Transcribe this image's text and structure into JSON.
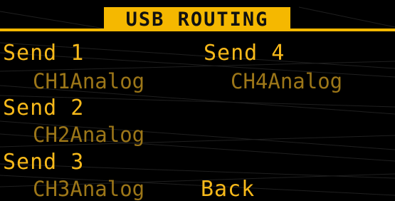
{
  "title": "USB ROUTING",
  "sends": [
    {
      "label": "Send 1",
      "source": "CH1Analog"
    },
    {
      "label": "Send 2",
      "source": "CH2Analog"
    },
    {
      "label": "Send 3",
      "source": "CH3Analog"
    },
    {
      "label": "Send 4",
      "source": "CH4Analog"
    }
  ],
  "back_label": "Back",
  "colors": {
    "accent": "#f5b800",
    "text_primary": "#f7b91a",
    "text_dim": "#9c7618",
    "background": "#000000"
  }
}
